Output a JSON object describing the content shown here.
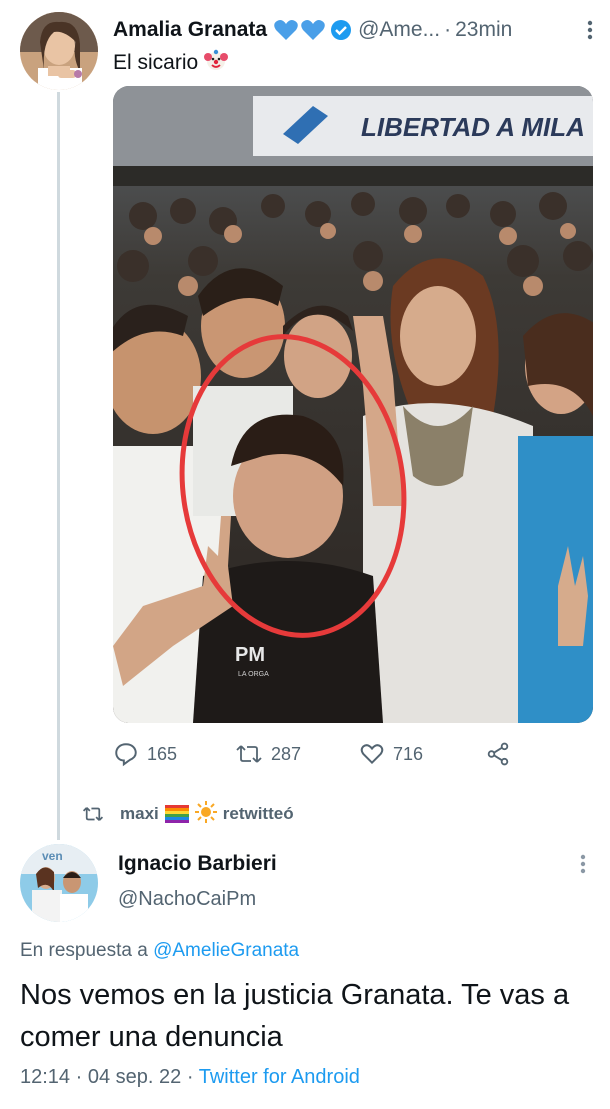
{
  "tweet": {
    "author_name": "Amalia Granata",
    "author_handle": "@Ame...",
    "separator": "·",
    "time": "23min",
    "text": "El sicario",
    "emoji": "clown-face",
    "image_banner_text": "LIBERTAD A MILA",
    "image_shirt_text": "PM",
    "image_shirt_subtext": "LA ORGA",
    "stats": {
      "replies": "165",
      "retweets": "287",
      "likes": "716"
    }
  },
  "retweet_banner": {
    "user": "maxi",
    "action": "retwitteó"
  },
  "reply_tweet": {
    "author_name": "Ignacio Barbieri",
    "author_handle": "@NachoCaiPm",
    "reply_prefix": "En respuesta a",
    "reply_handle": "@AmelieGranata",
    "text": "Nos vemos en la justicia Granata. Te vas a comer una denuncia",
    "time": "12:14",
    "date": "04 sep. 22",
    "separator": "·",
    "source": "Twitter for Android"
  },
  "colors": {
    "link": "#1d9bf0",
    "secondary": "#536471",
    "verified": "#1d9bf0",
    "hearts": "#4a9fe8"
  }
}
